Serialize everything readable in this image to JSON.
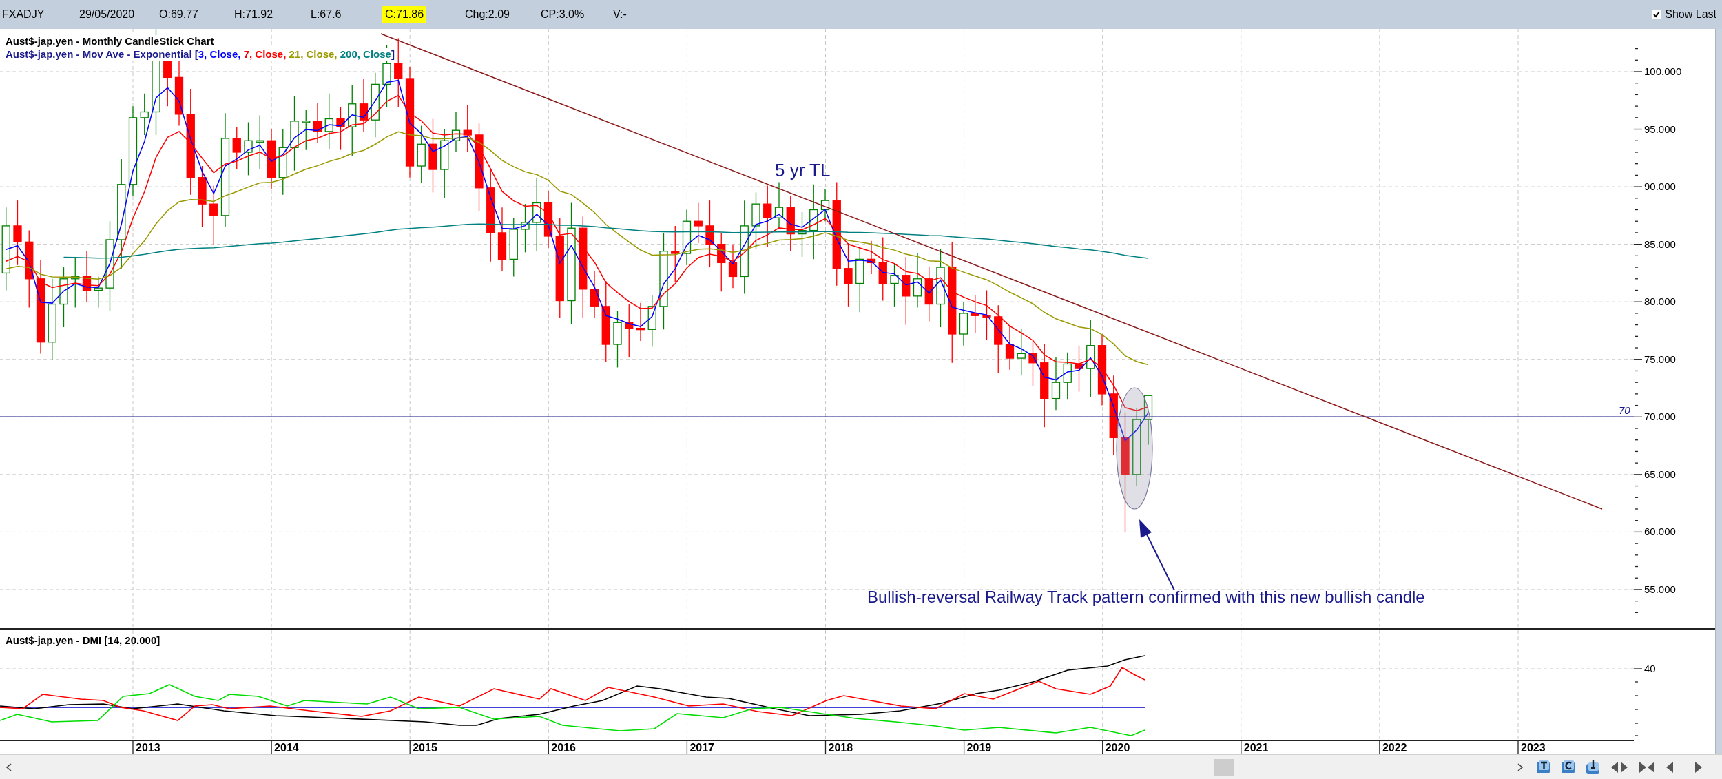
{
  "header": {
    "fields": [
      {
        "text": "FXADJY",
        "highlighted": false
      },
      {
        "text": "29/05/2020",
        "highlighted": false
      },
      {
        "text": "O:69.77",
        "highlighted": false
      },
      {
        "text": "H:71.92",
        "highlighted": false
      },
      {
        "text": "L:67.6",
        "highlighted": false
      },
      {
        "text": "C:71.86",
        "highlighted": true
      },
      {
        "text": "Chg:2.09",
        "highlighted": false
      },
      {
        "text": "CP:3.0%",
        "highlighted": false
      },
      {
        "text": "V:-",
        "highlighted": false
      }
    ]
  },
  "show_last": {
    "label": "Show Last",
    "checked": true
  },
  "price_chart": {
    "title": "Aust$-jap.yen - Monthly CandleStick Chart",
    "ma_legend": {
      "prefix": "Aust$-jap.yen - Mov Ave - Exponential [",
      "suffix": "]",
      "entries": [
        {
          "label": "3, Close,",
          "color": "#0000ff"
        },
        {
          "label": "7, Close,",
          "color": "#ff0000"
        },
        {
          "label": "21, Close,",
          "color": "#999900"
        },
        {
          "label": "200, Close",
          "color": "#008080"
        }
      ]
    },
    "y_labels": [
      "100.000",
      "95.000",
      "90.000",
      "85.000",
      "80.000",
      "75.000",
      "70.000",
      "65.000",
      "60.000",
      "55.000"
    ],
    "level_line_label": "70",
    "trendline_label": "5 yr TL",
    "pattern_note": "Bullish-reversal Railway Track pattern confirmed with this new bullish candle"
  },
  "dmi": {
    "title": "Aust$-jap.yen - DMI [14, 20.000]",
    "y_labels": [
      "40"
    ]
  },
  "x_labels": [
    "2013",
    "2014",
    "2015",
    "2016",
    "2017",
    "2018",
    "2019",
    "2020",
    "2021",
    "2022",
    "2023"
  ]
}
